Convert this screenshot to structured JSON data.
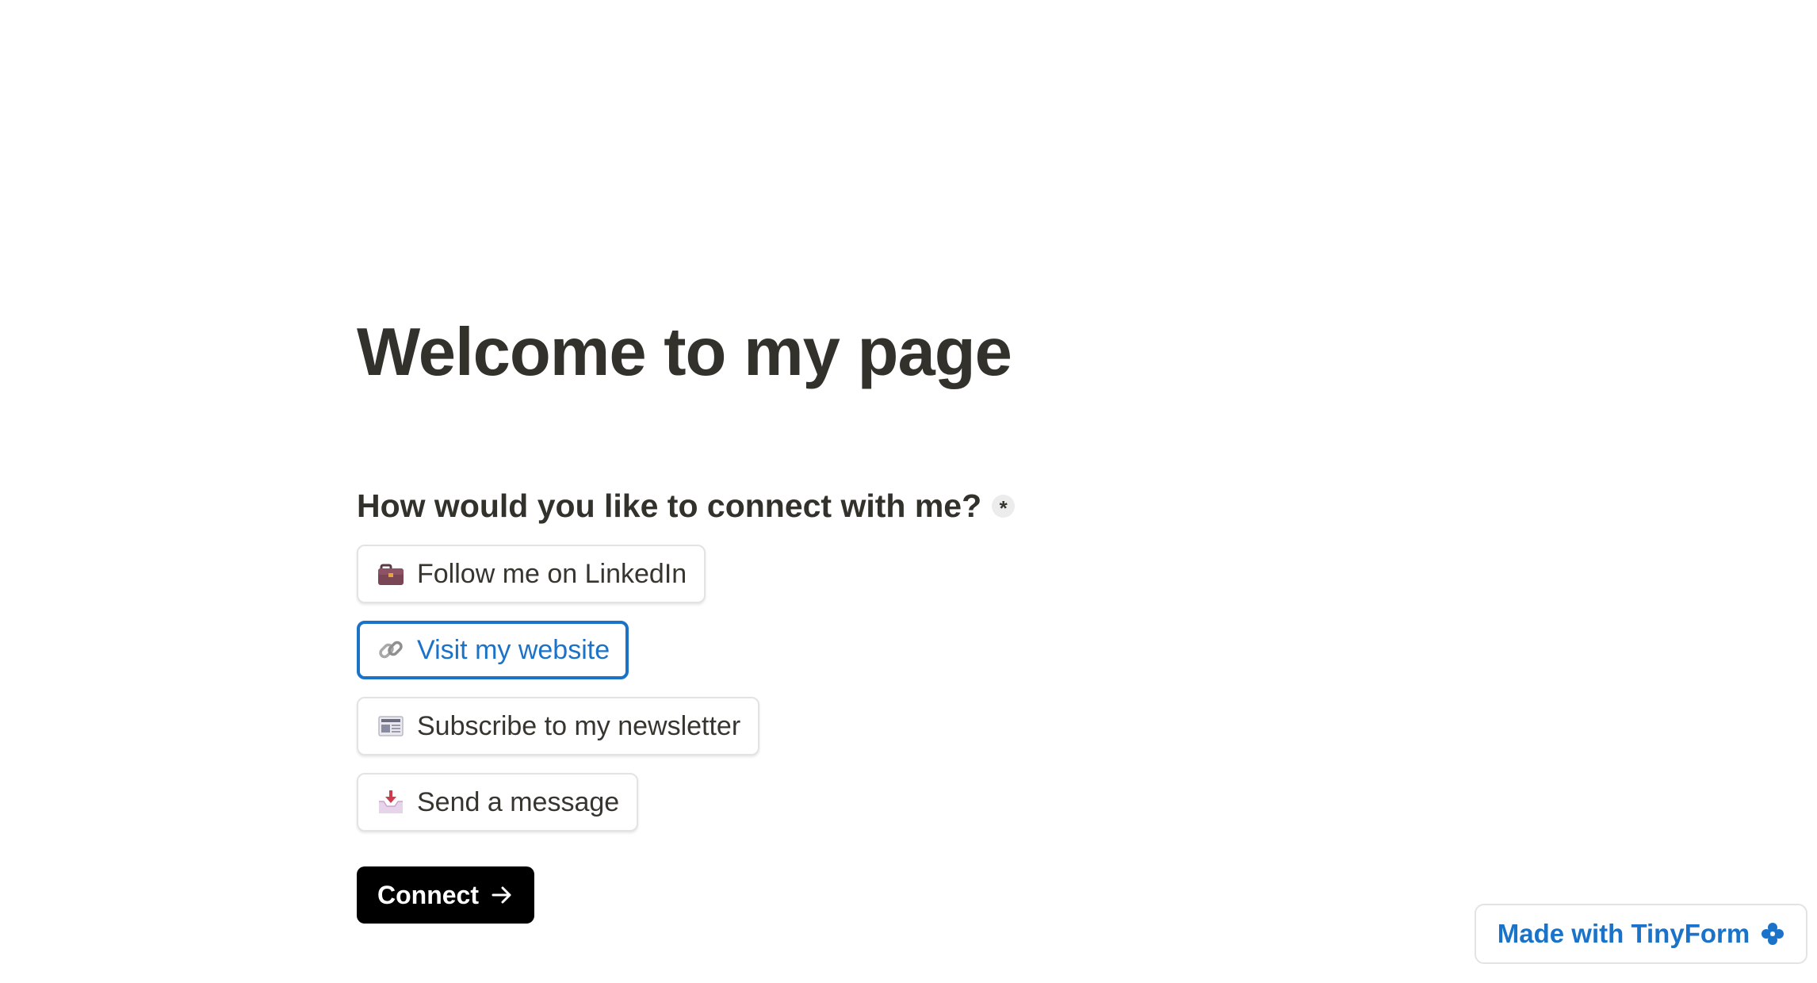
{
  "page": {
    "title": "Welcome to my page"
  },
  "question": {
    "label": "How would you like to connect with me?",
    "required_mark": "*"
  },
  "options": [
    {
      "label": "Follow me on LinkedIn",
      "icon": "briefcase-icon",
      "selected": false
    },
    {
      "label": "Visit my website",
      "icon": "link-icon",
      "selected": true
    },
    {
      "label": "Subscribe to my newsletter",
      "icon": "newspaper-icon",
      "selected": false
    },
    {
      "label": "Send a message",
      "icon": "inbox-tray-icon",
      "selected": false
    }
  ],
  "submit": {
    "label": "Connect",
    "icon": "arrow-right-icon"
  },
  "badge": {
    "label": "Made with TinyForm",
    "icon": "flower-icon"
  },
  "colors": {
    "accent": "#1a73c9",
    "text": "#37352f",
    "button_bg": "#000000"
  }
}
